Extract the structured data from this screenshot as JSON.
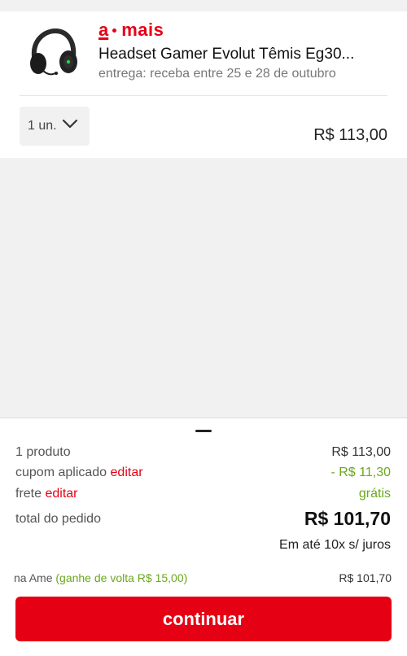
{
  "brand": {
    "prefix": "a",
    "name": "mais"
  },
  "product": {
    "title": "Headset Gamer Evolut Têmis Eg30...",
    "delivery": "entrega: receba entre 25 e 28 de outubro",
    "quantity": "1 un.",
    "price": "R$ 113,00",
    "image_icon": "headset-icon"
  },
  "summary": {
    "products_label": "1 produto",
    "products_value": "R$ 113,00",
    "coupon_label": "cupom aplicado",
    "coupon_edit": "editar",
    "coupon_value": "- R$ 11,30",
    "shipping_label": "frete",
    "shipping_edit": "editar",
    "shipping_value": "grátis",
    "total_label": "total do pedido",
    "total_value": "R$ 101,70",
    "installments": "Em até 10x s/ juros"
  },
  "ame": {
    "label": "na Ame",
    "cashback": "(ganhe de volta R$ 15,00)",
    "value": "R$ 101,70"
  },
  "actions": {
    "continue_label": "continuar"
  },
  "colors": {
    "brand_red": "#e60014",
    "discount_green": "#6aa81d",
    "background": "#f1f1f1"
  }
}
